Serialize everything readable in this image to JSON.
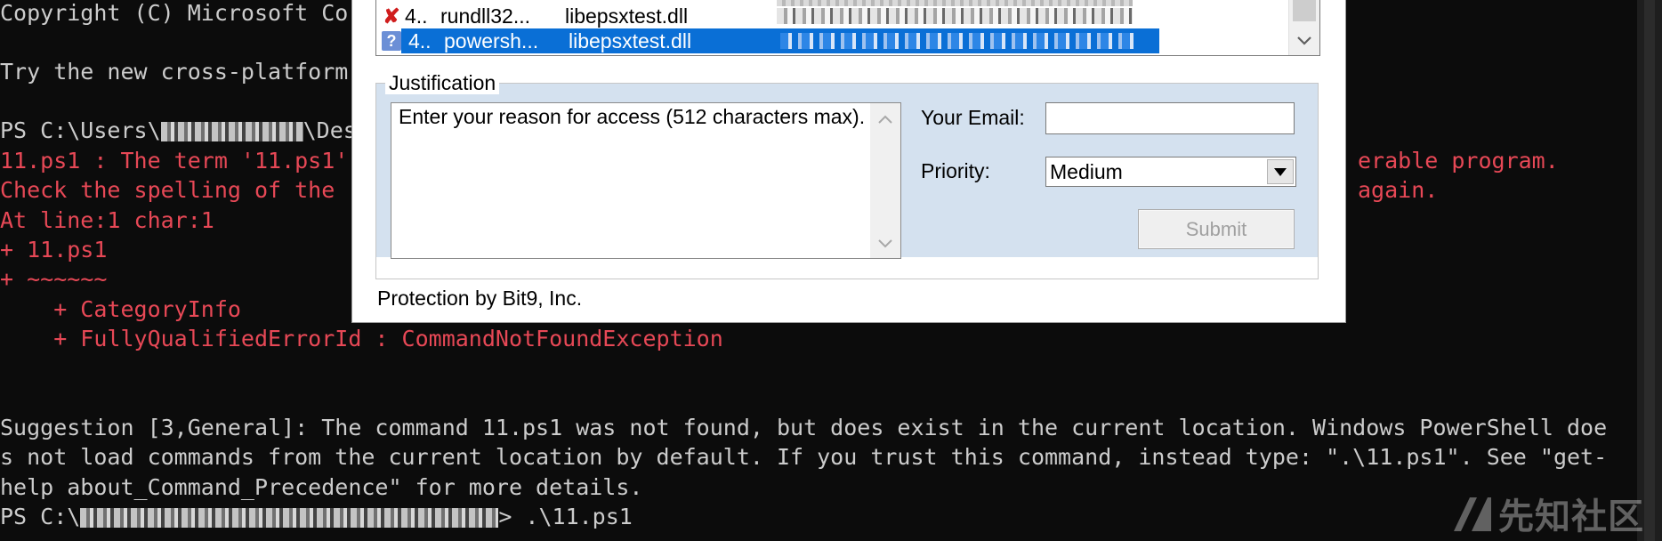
{
  "terminal": {
    "lines": {
      "copyright": "Copyright (C) Microsoft Co",
      "try_new": "Try the new cross-platform",
      "prompt_prefix": "PS C:\\Users\\",
      "prompt_suffix": "\\Des",
      "error_left_1": "11.ps1 : The term '11.ps1'",
      "error_right_1": "erable program.",
      "error_left_2": "Check the spelling of the",
      "error_right_2": "again.",
      "error_3": "At line:1 char:1",
      "error_4": "+ 11.ps1",
      "error_5": "+ ~~~~~~",
      "error_6": "    + CategoryInfo",
      "error_7": "    + FullyQualifiedErrorId : CommandNotFoundException",
      "suggestion_1": "Suggestion [3,General]: The command 11.ps1 was not found, but does exist in the current location. Windows PowerShell doe",
      "suggestion_2": "s not load commands from the current location by default. If you trust this command, instead type: \".\\11.ps1\". See \"get-",
      "suggestion_3": "help about_Command_Precedence\" for more details.",
      "final_prompt_prefix": "PS C:\\",
      "final_prompt_suffix": "> .\\11.ps1"
    },
    "colors": {
      "background": "#0c0c0c",
      "text": "#cccccc",
      "error": "#e74856"
    }
  },
  "watermark": {
    "text": "先知社区",
    "icon": "xianzhi-logo-icon"
  },
  "dialog": {
    "file_list": {
      "rows": [
        {
          "status": "✘",
          "pid": "4..",
          "process": "rundll32...",
          "file": "libepsxtest.dll",
          "status_icon": "red-x-icon"
        },
        {
          "status": "?",
          "pid": "4..",
          "process": "powersh...",
          "file": "libepsxtest.dll",
          "status_icon": "question-icon",
          "selected": true
        }
      ],
      "partial_row": {
        "process": "",
        "file": ""
      },
      "selection_color": "#0a6fd6"
    },
    "justification": {
      "legend": "Justification",
      "reason_placeholder": "Enter your reason for access (512 characters max).",
      "email_label": "Your Email:",
      "email_value": "",
      "priority_label": "Priority:",
      "priority_value": "Medium",
      "submit_label": "Submit",
      "group_color": "#d4e1ef"
    },
    "footer": "Protection by Bit9, Inc."
  }
}
